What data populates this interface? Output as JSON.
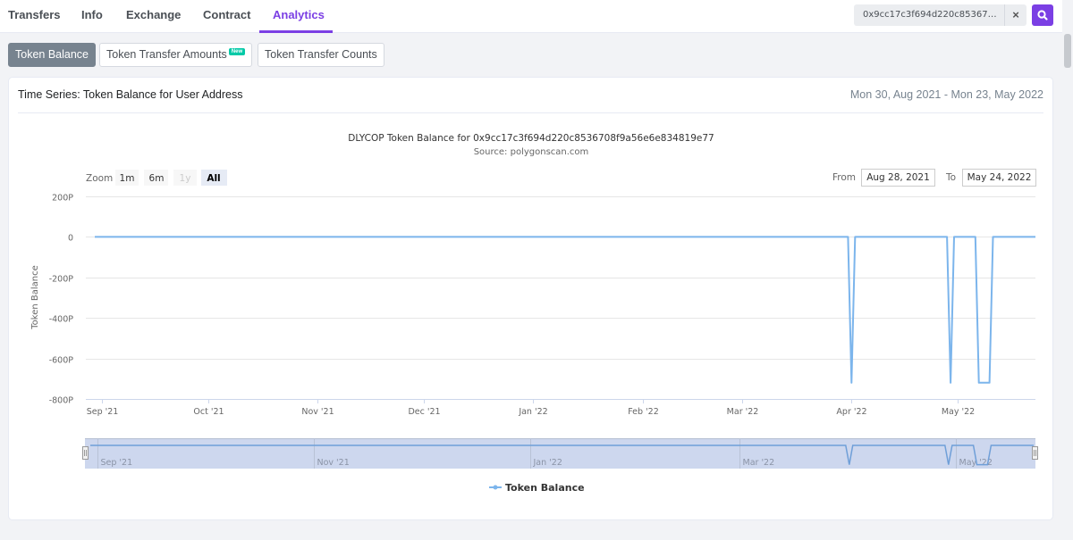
{
  "nav": {
    "tabs": [
      {
        "label": "Transfers"
      },
      {
        "label": "Info"
      },
      {
        "label": "Exchange"
      },
      {
        "label": "Contract"
      },
      {
        "label": "Analytics"
      }
    ],
    "active_tab": "Analytics",
    "search_value": "0x9cc17c3f694d220c8536708f9a56e6e834819e77",
    "clear_symbol": "×"
  },
  "subtabs": [
    {
      "label": "Token Balance",
      "active": true
    },
    {
      "label": "Token Transfer Amounts",
      "badge": "New"
    },
    {
      "label": "Token Transfer Counts"
    }
  ],
  "card": {
    "title": "Time Series: Token Balance for User Address",
    "date_range": "Mon 30, Aug 2021 - Mon 23, May 2022"
  },
  "colors": {
    "accent": "#7b3fe4",
    "series": "#7cb5ec",
    "navigator_fill": "#cdd7ee"
  },
  "chart_data": {
    "type": "line",
    "title": "DLYCOP Token Balance for 0x9cc17c3f694d220c8536708f9a56e6e834819e77",
    "subtitle": "Source: polygonscan.com",
    "ylabel": "Token Balance",
    "xlabel": "",
    "ylim": [
      -800,
      200
    ],
    "y_unit": "P",
    "yticks": [
      "200P",
      "0",
      "-200P",
      "-400P",
      "-600P",
      "-800P"
    ],
    "ytick_values": [
      200,
      0,
      -200,
      -400,
      -600,
      -800
    ],
    "x_range": [
      "2021-08-30",
      "2022-05-23"
    ],
    "xticks": [
      {
        "date": "2021-09-01",
        "label": "Sep '21"
      },
      {
        "date": "2021-10-01",
        "label": "Oct '21"
      },
      {
        "date": "2021-11-01",
        "label": "Nov '21"
      },
      {
        "date": "2021-12-01",
        "label": "Dec '21"
      },
      {
        "date": "2022-01-01",
        "label": "Jan '22"
      },
      {
        "date": "2022-02-01",
        "label": "Feb '22"
      },
      {
        "date": "2022-03-01",
        "label": "Mar '22"
      },
      {
        "date": "2022-04-01",
        "label": "Apr '22"
      },
      {
        "date": "2022-05-01",
        "label": "May '22"
      }
    ],
    "navigator_ticks": [
      {
        "date": "2021-09-01",
        "label": "Sep '21"
      },
      {
        "date": "2021-11-01",
        "label": "Nov '21"
      },
      {
        "date": "2022-01-01",
        "label": "Jan '22"
      },
      {
        "date": "2022-03-01",
        "label": "Mar '22"
      },
      {
        "date": "2022-05-01",
        "label": "May '22"
      }
    ],
    "grid": true,
    "legend_position": "bottom-center",
    "series": [
      {
        "name": "Token Balance",
        "points": [
          {
            "x": "2021-08-30",
            "y": 0
          },
          {
            "x": "2022-03-31",
            "y": 0
          },
          {
            "x": "2022-04-01",
            "y": -720
          },
          {
            "x": "2022-04-02",
            "y": 0
          },
          {
            "x": "2022-04-28",
            "y": 0
          },
          {
            "x": "2022-04-29",
            "y": -720
          },
          {
            "x": "2022-04-30",
            "y": 0
          },
          {
            "x": "2022-05-06",
            "y": 0
          },
          {
            "x": "2022-05-07",
            "y": -720
          },
          {
            "x": "2022-05-10",
            "y": -720
          },
          {
            "x": "2022-05-11",
            "y": 0
          },
          {
            "x": "2022-05-23",
            "y": 0
          }
        ]
      }
    ],
    "zoom": {
      "label": "Zoom",
      "buttons": [
        "1m",
        "6m",
        "1y",
        "All"
      ],
      "active": "All",
      "disabled": [
        "1y"
      ]
    },
    "range_inputs": {
      "from_label": "From",
      "from": "Aug 28, 2021",
      "to_label": "To",
      "to": "May 24, 2022"
    }
  }
}
